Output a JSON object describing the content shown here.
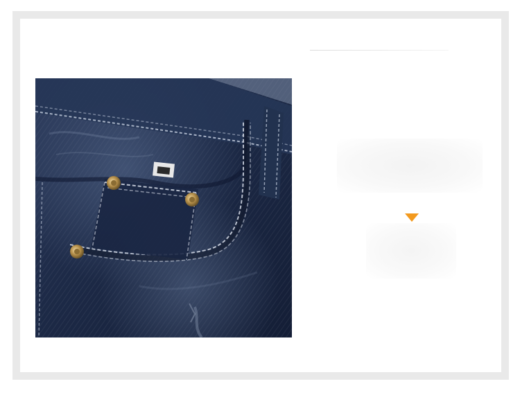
{
  "image": {
    "subject": "denim-jeans-coin-pocket-closeup",
    "accent_color": "#f39a1e",
    "frame_color": "#e9e9e9",
    "denim_color": "#1f2d4b"
  },
  "marker": {
    "icon": "triangle-down-icon",
    "color": "#f39a1e"
  }
}
